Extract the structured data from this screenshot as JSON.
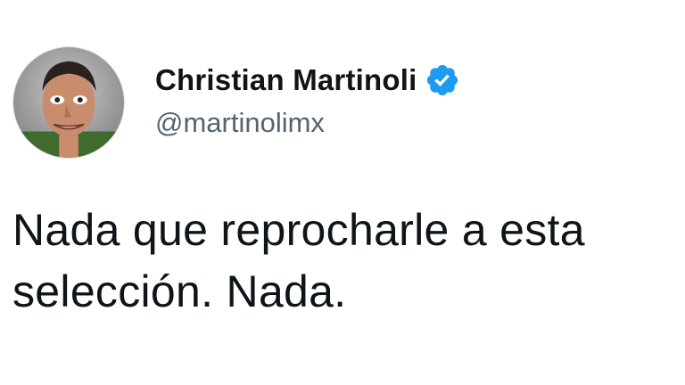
{
  "author": {
    "display_name": "Christian Martinoli",
    "handle": "@martinolimx",
    "verified": true,
    "avatar_icon": "profile-photo",
    "verified_icon": "verified-badge-icon",
    "verified_color": "#1d9bf0"
  },
  "tweet": {
    "lines": [
      "Nada que reprocharle a esta",
      "selección. Nada."
    ]
  }
}
